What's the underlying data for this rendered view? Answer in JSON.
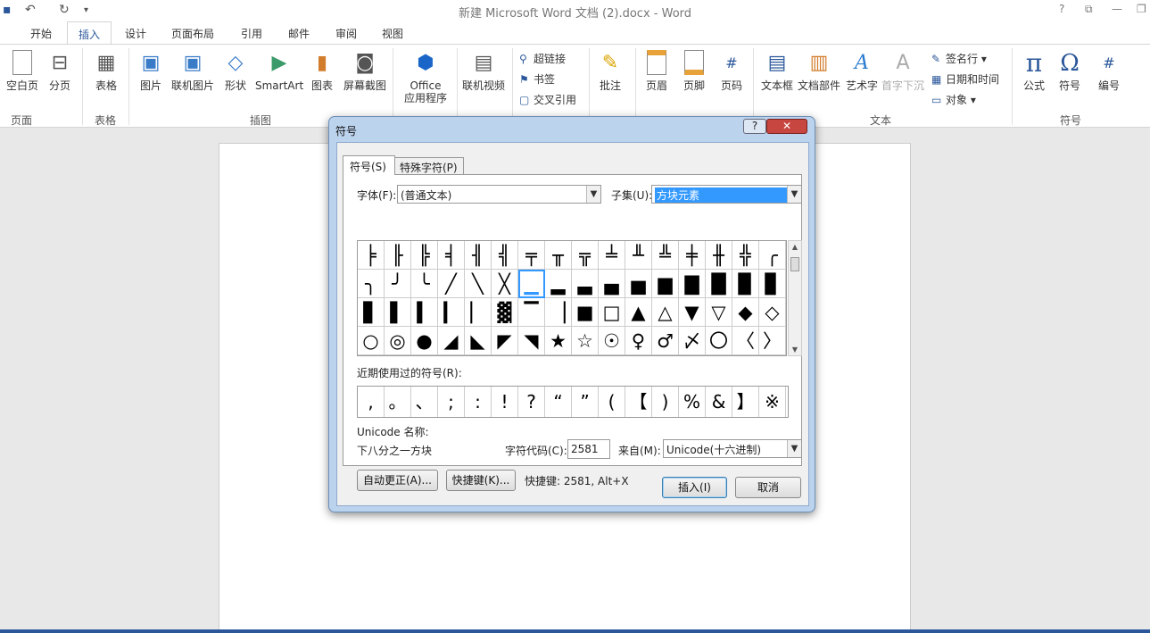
{
  "window": {
    "title": "新建 Microsoft Word 文档 (2).docx - Word",
    "help": "?",
    "qa_undo": "↶",
    "qa_redo": "↻",
    "qa_more": "▾"
  },
  "tabs": [
    "开始",
    "插入",
    "设计",
    "页面布局",
    "引用",
    "邮件",
    "审阅",
    "视图"
  ],
  "ribbon": {
    "buttons": {
      "blank_page": "空白页",
      "page_break": "分页",
      "table": "表格",
      "pictures": "图片",
      "online_pictures": "联机图片",
      "shapes": "形状",
      "smartart": "SmartArt",
      "chart": "图表",
      "screenshot": "屏幕截图",
      "office_apps_1": "Office",
      "office_apps_2": "应用程序",
      "online_video": "联机视频",
      "hyperlink": "超链接",
      "bookmark": "书签",
      "cross_ref": "交叉引用",
      "comment": "批注",
      "header": "页眉",
      "footer": "页脚",
      "page_number": "页码",
      "text_box": "文本框",
      "quick_parts": "文档部件",
      "wordart": "艺术字",
      "drop_cap": "首字下沉",
      "signature_line": "签名行",
      "date_time": "日期和时间",
      "object": "对象",
      "equation": "公式",
      "symbol": "符号",
      "number": "编号"
    },
    "groups": {
      "pages": "页面",
      "tables": "表格",
      "illustrations": "插图",
      "text": "文本",
      "symbols": "符号"
    }
  },
  "dialog": {
    "title": "符号",
    "help": "?",
    "close": "✕",
    "tab_symbols": "符号(S)",
    "tab_special": "特殊字符(P)",
    "font_label": "字体(F):",
    "font_value": "(普通文本)",
    "subset_label": "子集(U):",
    "subset_value": "方块元素",
    "grid": [
      "╞",
      "╟",
      "╠",
      "╡",
      "╢",
      "╣",
      "╤",
      "╥",
      "╦",
      "╧",
      "╨",
      "╩",
      "╪",
      "╫",
      "╬",
      "╭",
      "╮",
      "╯",
      "╰",
      "╱",
      "╲",
      "╳",
      "▁",
      "▂",
      "▃",
      "▄",
      "▅",
      "▆",
      "▇",
      "█",
      "▉",
      "▊",
      "▋",
      "▌",
      "▍",
      "▎",
      "▏",
      "▓",
      "▔",
      "▕",
      "■",
      "□",
      "▲",
      "△",
      "▼",
      "▽",
      "◆",
      "◇",
      "○",
      "◎",
      "●",
      "◢",
      "◣",
      "◤",
      "◥",
      "★",
      "☆",
      "☉",
      "♀",
      "♂",
      "〆",
      "〇",
      "〈",
      "〉"
    ],
    "selected_index": 22,
    "recent_label": "近期使用过的符号(R):",
    "recent": [
      ",",
      "。",
      "、",
      ";",
      ":",
      "!",
      "?",
      "“",
      "”",
      "(",
      "【",
      ")",
      "%",
      "&",
      "】",
      "※"
    ],
    "unicode_name_label": "Unicode 名称:",
    "unicode_name": "下八分之一方块",
    "code_label": "字符代码(C):",
    "code_value": "2581",
    "from_label": "来自(M):",
    "from_value": "Unicode(十六进制)",
    "autocorrect_btn": "自动更正(A)...",
    "shortcut_btn": "快捷键(K)...",
    "shortcut_text": "快捷键: 2581, Alt+X",
    "insert_btn": "插入(I)",
    "cancel_btn": "取消"
  }
}
